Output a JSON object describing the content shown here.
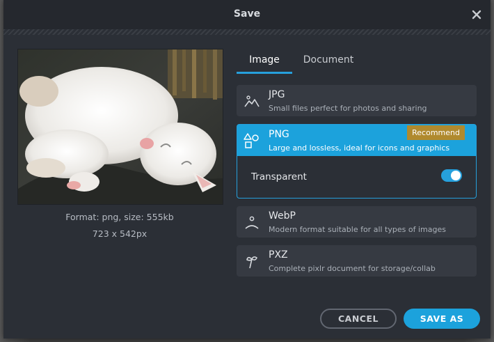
{
  "dialog": {
    "title": "Save"
  },
  "preview": {
    "format_text": "Format: png, size: 555kb",
    "dimensions_text": "723 x 542px"
  },
  "tabs": [
    {
      "label": "Image",
      "active": true
    },
    {
      "label": "Document",
      "active": false
    }
  ],
  "options": {
    "jpg": {
      "name": "JPG",
      "desc": "Small files perfect for photos and sharing",
      "icon": "landscape-icon"
    },
    "png": {
      "name": "PNG",
      "desc": "Large and lossless, ideal for icons and graphics",
      "icon": "shapes-icon",
      "badge": "Recommend",
      "selected": true
    },
    "webp": {
      "name": "WebP",
      "desc": "Modern format suitable for all types of images",
      "icon": "person-icon"
    },
    "pxz": {
      "name": "PXZ",
      "desc": "Complete pixlr document for storage/collab",
      "icon": "pixlr-icon"
    }
  },
  "transparent": {
    "label": "Transparent",
    "enabled": true
  },
  "buttons": {
    "cancel": "CANCEL",
    "save_as": "SAVE AS"
  },
  "colors": {
    "accent": "#1ca2dc",
    "badge": "#b08a2e",
    "dialog_bg": "#2b2f36"
  }
}
